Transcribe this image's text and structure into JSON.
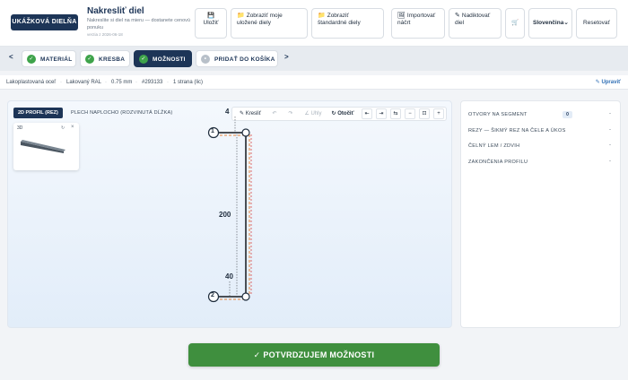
{
  "header": {
    "logo": "UKÁŽKOVÁ DIELŇA",
    "title": "Nakresliť diel",
    "subtitle": "Nakreslite si diel na mieru — dostanete cenovú ponuku",
    "version": "verzia z 2026-06-18",
    "buttons": {
      "save": "Uložiť",
      "saved_parts": "Zobraziť moje uložené diely",
      "standard_parts": "Zobraziť štandardné diely",
      "import": "Importovať náčrt",
      "sketch": "Nadiktovať diel",
      "reset": "Resetovať"
    },
    "language": "Slovenčina"
  },
  "steps": {
    "prev": "<",
    "next": ">",
    "items": [
      "MATERIÁL",
      "KRESBA",
      "MOŽNOSTI",
      "PRIDAŤ DO KOŠÍKA"
    ]
  },
  "spec": {
    "material": "Lakoplastovaná oceľ",
    "coating": "Lakovaný RAL",
    "thickness": "0.75 mm",
    "code": "#293133",
    "sides": "1 strana (lic)",
    "edit": "Upraviť"
  },
  "canvas": {
    "tab_2d": "2D PROFIL (REZ)",
    "tab_flat": "PLECH NAPLOCHO (ROZVINUTÁ DĹŽKA)",
    "mini_label": "3D",
    "toolbar": {
      "draw": "Kresliť",
      "angles": "Uhly",
      "rotate": "Otočiť"
    },
    "dims": {
      "top": "4",
      "middle": "200",
      "bottom": "40"
    },
    "points": [
      "1",
      "2"
    ]
  },
  "options": {
    "items": [
      {
        "label": "OTVORY NA SEGMENT",
        "badge": "0",
        "action": "-"
      },
      {
        "label": "REZY — ŠIKMÝ REZ NA ČELE A ÚKOS",
        "action": "-"
      },
      {
        "label": "ČELNÝ LEM / ZDVIH",
        "action": "-"
      },
      {
        "label": "ZAKONČENIA PROFILU",
        "action": "-"
      }
    ]
  },
  "confirm_label": "✓ POTVRDZUJEM MOŽNOSTI",
  "colors": {
    "brand": "#1d3557",
    "success": "#3f8f3e",
    "dash_orange": "#e8833a",
    "dash_red": "#d84a4a"
  }
}
